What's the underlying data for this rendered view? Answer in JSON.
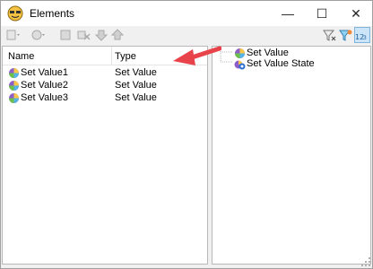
{
  "window": {
    "title": "Elements",
    "minimize_glyph": "—",
    "maximize_glyph": "☐",
    "close_glyph": "✕"
  },
  "toolbar": {
    "search": {
      "value": "",
      "placeholder": ""
    }
  },
  "list": {
    "columns": [
      "Name",
      "Type"
    ],
    "rows": [
      {
        "name": "Set Value1",
        "type": "Set Value"
      },
      {
        "name": "Set Value2",
        "type": "Set Value"
      },
      {
        "name": "Set Value3",
        "type": "Set Value"
      }
    ]
  },
  "tree": {
    "nodes": [
      {
        "label": "Set Value"
      },
      {
        "label": "Set Value State"
      }
    ]
  },
  "colors": {
    "accent": "#e8434a",
    "selected": "#cce4f7"
  }
}
